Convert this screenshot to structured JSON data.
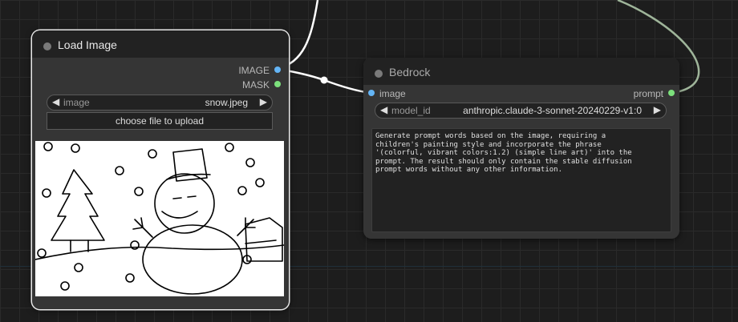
{
  "load_image": {
    "title": "Load Image",
    "outputs": [
      "IMAGE",
      "MASK"
    ],
    "image_widget": {
      "label": "image",
      "value": "snow.jpeg"
    },
    "upload_label": "choose file to upload"
  },
  "bedrock": {
    "title": "Bedrock",
    "input": "image",
    "output": "prompt",
    "model_widget": {
      "label": "model_id",
      "value": "anthropic.claude-3-sonnet-20240229-v1:0"
    },
    "prompt_text": "Generate prompt words based on the image, requiring a\nchildren's painting style and incorporate the phrase\n'(colorful, vibrant colors:1.2) (simple line art)' into the\nprompt. The result should only contain the stable diffusion\nprompt words without any other information."
  },
  "colors": {
    "canvas_bg": "#1d1d1d",
    "node_bg": "#353535",
    "image_slot": "#64b5f6",
    "mask_slot": "#7ce07c",
    "link_image": "#ffffff",
    "link_prompt": "#9fb59a"
  },
  "icons": [
    "arrow-left-icon",
    "arrow-right-icon",
    "node-status-dot-icon",
    "snowman-drawing"
  ]
}
